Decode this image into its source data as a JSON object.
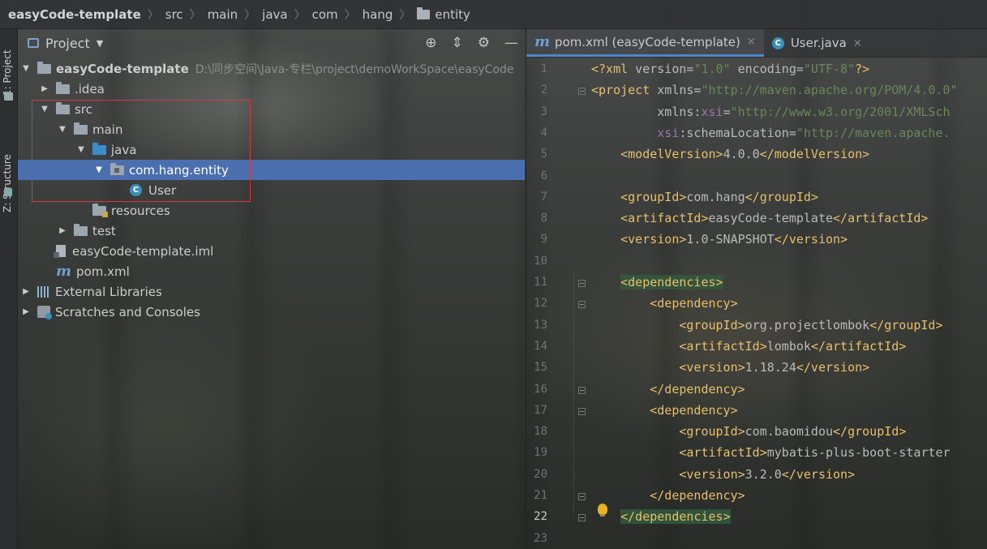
{
  "breadcrumb": {
    "items": [
      "easyCode-template",
      "src",
      "main",
      "java",
      "com",
      "hang",
      "entity"
    ]
  },
  "toolstrip": {
    "project_tab": "1: Project",
    "structure_tab": "Z: Structure"
  },
  "project_panel": {
    "title": "Project",
    "tree": [
      {
        "label": "easyCode-template",
        "hint": "D:\\同步空间\\Java-专栏\\project\\demoWorkSpace\\easyCode",
        "icon": "module-folder-icon",
        "expanded": true
      },
      {
        "label": ".idea",
        "icon": "folder-icon",
        "expanded": false
      },
      {
        "label": "src",
        "icon": "folder-icon",
        "expanded": true
      },
      {
        "label": "main",
        "icon": "folder-icon",
        "expanded": true
      },
      {
        "label": "java",
        "icon": "source-folder-icon",
        "expanded": true
      },
      {
        "label": "com.hang.entity",
        "icon": "package-icon",
        "expanded": true,
        "selected": true
      },
      {
        "label": "User",
        "icon": "class-icon"
      },
      {
        "label": "resources",
        "icon": "resources-folder-icon"
      },
      {
        "label": "test",
        "icon": "folder-icon",
        "expanded": false
      },
      {
        "label": "easyCode-template.iml",
        "icon": "iml-file-icon"
      },
      {
        "label": "pom.xml",
        "icon": "maven-icon"
      },
      {
        "label": "External Libraries",
        "icon": "library-icon",
        "expanded": false
      },
      {
        "label": "Scratches and Consoles",
        "icon": "scratch-icon",
        "expanded": false
      }
    ]
  },
  "editor": {
    "tabs": [
      {
        "label": "pom.xml (easyCode-template)",
        "icon": "maven-icon",
        "active": true
      },
      {
        "label": "User.java",
        "icon": "class-icon",
        "active": false
      }
    ],
    "current_line": 22,
    "lines": [
      "<?xml version=\"1.0\" encoding=\"UTF-8\"?>",
      "<project xmlns=\"http://maven.apache.org/POM/4.0.0\"",
      "         xmlns:xsi=\"http://www.w3.org/2001/XMLSch",
      "         xsi:schemaLocation=\"http://maven.apache.",
      "    <modelVersion>4.0.0</modelVersion>",
      "",
      "    <groupId>com.hang</groupId>",
      "    <artifactId>easyCode-template</artifactId>",
      "    <version>1.0-SNAPSHOT</version>",
      "",
      "    <dependencies>",
      "        <dependency>",
      "            <groupId>org.projectlombok</groupId>",
      "            <artifactId>lombok</artifactId>",
      "            <version>1.18.24</version>",
      "        </dependency>",
      "        <dependency>",
      "            <groupId>com.baomidou</groupId>",
      "            <artifactId>mybatis-plus-boot-starter",
      "            <version>3.2.0</version>",
      "        </dependency>",
      "    </dependencies>",
      ""
    ]
  },
  "colors": {
    "selection": "#4b6eaf",
    "highlight_box": "#d23c3c",
    "xml_tag": "#e8bf6a",
    "xml_value": "#6a8759",
    "namespace": "#9876aa"
  }
}
